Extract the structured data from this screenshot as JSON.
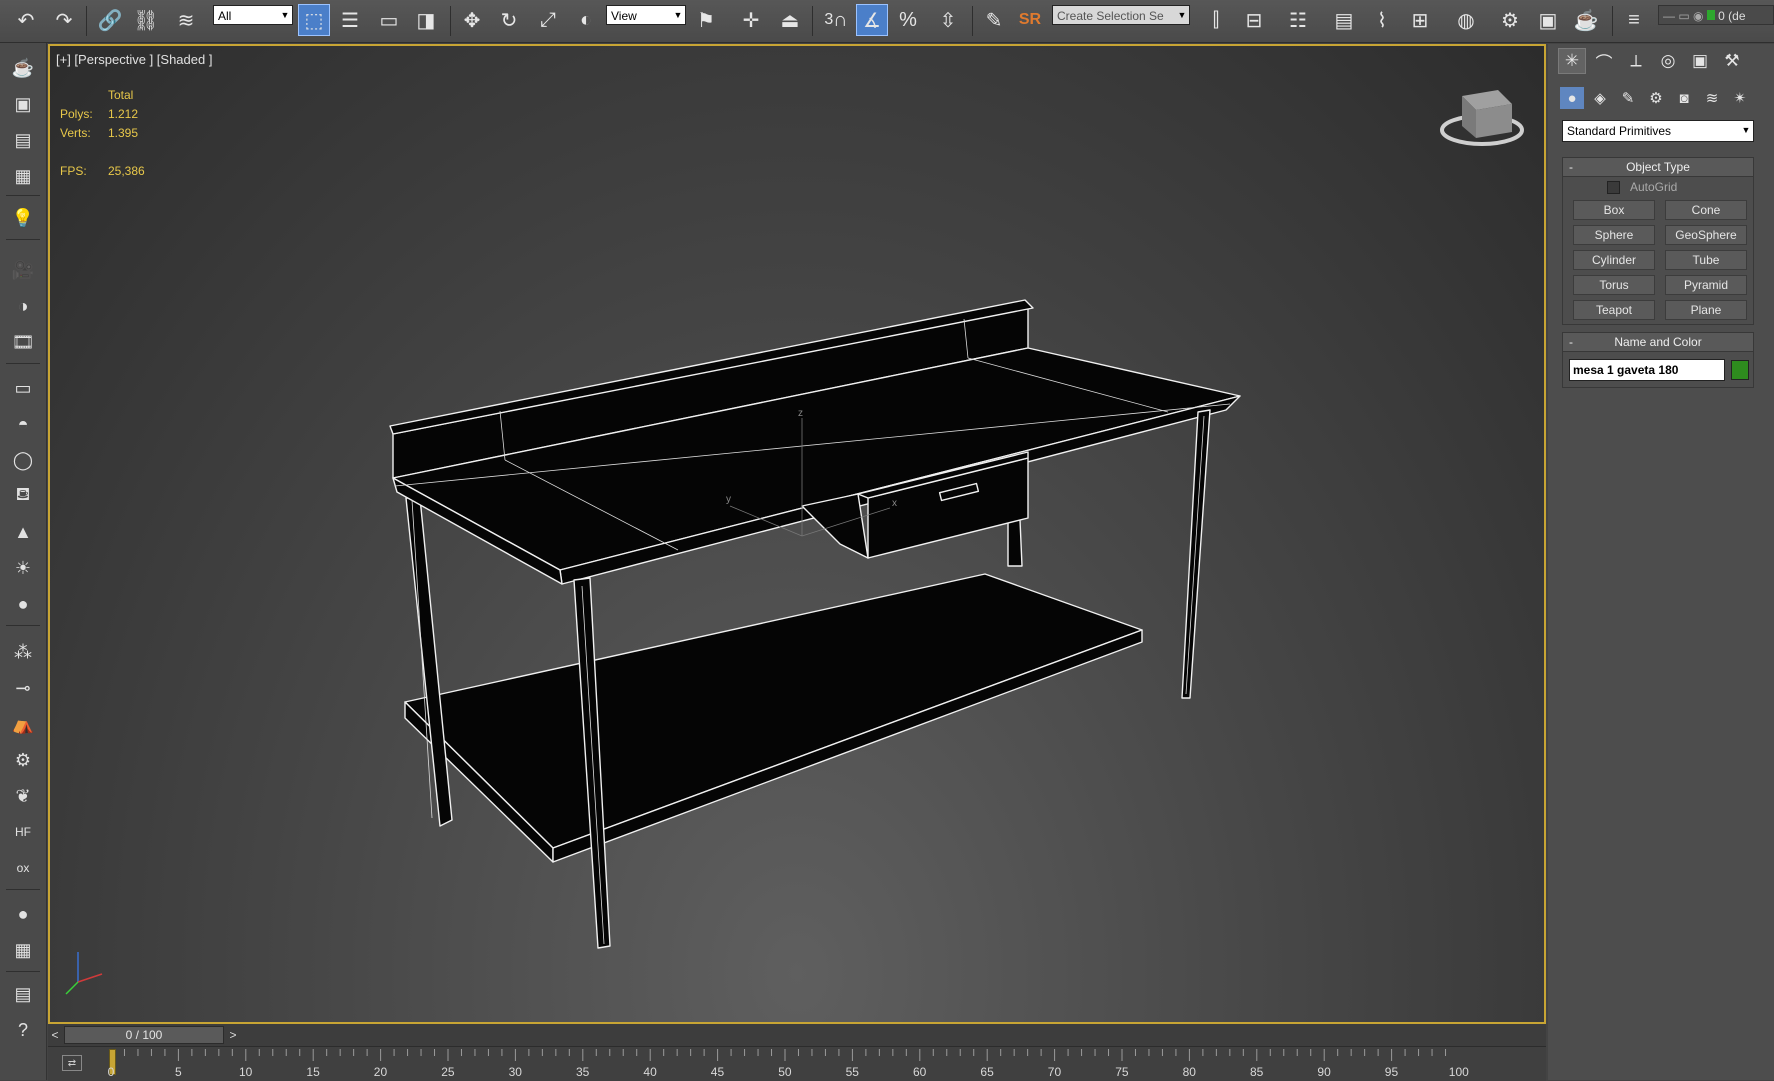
{
  "toolbar": {
    "selection_filter": "All",
    "ref_coord": "View",
    "named_selection": "Create Selection Se",
    "snap_angle_label": "3",
    "sr_label": "SR",
    "layer_label": "0 (de",
    "icons": [
      "undo-icon",
      "redo-icon",
      "link-icon",
      "unlink-icon",
      "bind-space-warp-icon",
      "select-object-icon",
      "select-by-name-icon",
      "rect-region-icon",
      "window-crossing-icon",
      "move-icon",
      "rotate-icon",
      "scale-icon",
      "placement-icon",
      "select-manipulate-icon",
      "pivot-icon",
      "align-view-icon",
      "snap-toggle-icon",
      "angle-snap-icon",
      "percent-snap-icon",
      "spinner-snap-icon",
      "edit-named-selection-icon",
      "mirror-icon",
      "align-icon",
      "layer-explorer-icon",
      "scene-explorer-icon",
      "curve-editor-icon",
      "schematic-view-icon",
      "material-editor-icon",
      "render-setup-icon",
      "rendered-frame-icon",
      "render-icon",
      "render-iterative-icon",
      "layer-manager-icon"
    ]
  },
  "viewport": {
    "label": "[+] [Perspective ] [Shaded ]",
    "stats": {
      "header": "Total",
      "polys_label": "Polys:",
      "polys_value": "1.212",
      "verts_label": "Verts:",
      "verts_value": "1.395",
      "fps_label": "FPS:",
      "fps_value": "25,386"
    },
    "axis_labels": {
      "x": "x",
      "y": "y",
      "z": "z"
    }
  },
  "command_panel": {
    "tabs": [
      "create-tab",
      "modify-tab",
      "hierarchy-tab",
      "motion-tab",
      "display-tab",
      "utilities-tab"
    ],
    "subtabs": [
      "geometry-subtab",
      "shapes-subtab",
      "lights-subtab",
      "cameras-subtab",
      "helpers-subtab",
      "spacewarps-subtab",
      "systems-subtab"
    ],
    "category": "Standard Primitives",
    "object_type": {
      "title": "Object Type",
      "autogrid_label": "AutoGrid",
      "buttons": [
        "Box",
        "Cone",
        "Sphere",
        "GeoSphere",
        "Cylinder",
        "Tube",
        "Torus",
        "Pyramid",
        "Teapot",
        "Plane"
      ]
    },
    "name_color": {
      "title": "Name and Color",
      "object_name": "mesa 1 gaveta 180",
      "color": "#2e8b1e"
    }
  },
  "time": {
    "slider_label": "0 / 100",
    "prev": "<",
    "next": ">",
    "ticks": [
      "0",
      "5",
      "10",
      "15",
      "20",
      "25",
      "30",
      "35",
      "40",
      "45",
      "50",
      "55",
      "60",
      "65",
      "70",
      "75",
      "80",
      "85",
      "90",
      "95",
      "100"
    ]
  },
  "colors": {
    "viewport_border": "#c8a534",
    "stats_text": "#e8c84a",
    "active_blue": "#4b7fc9"
  }
}
